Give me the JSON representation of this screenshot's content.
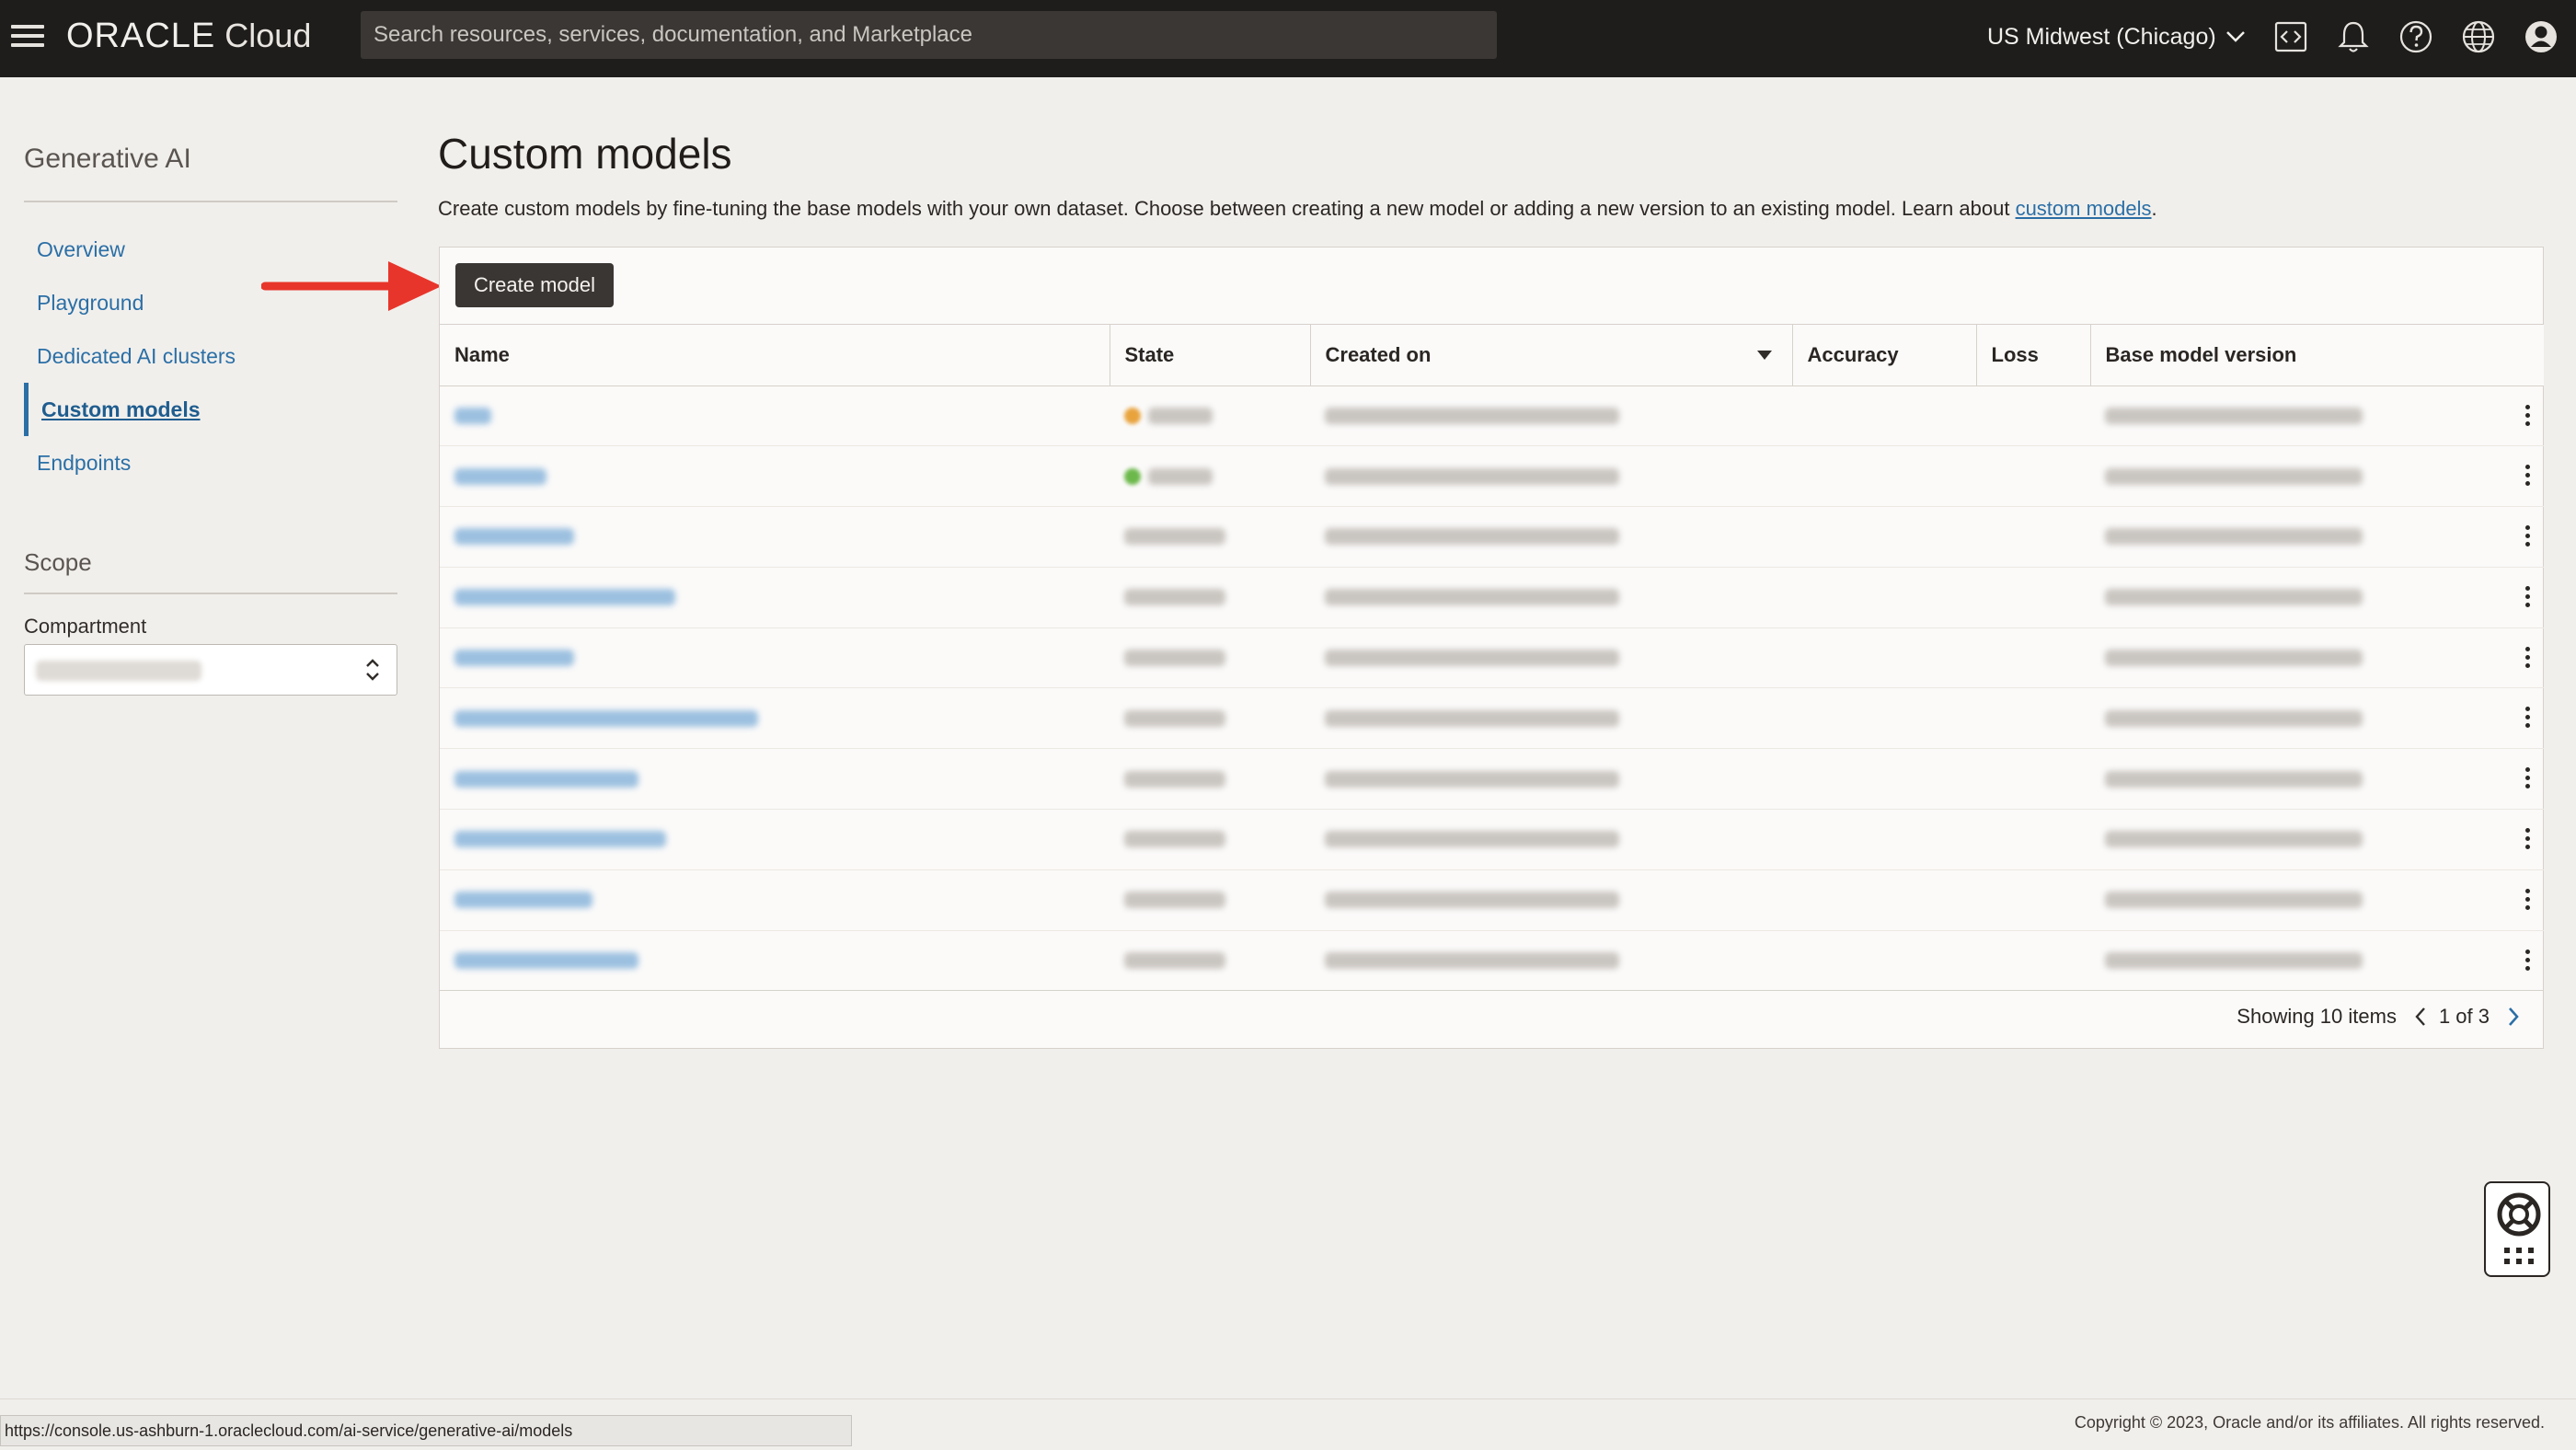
{
  "header": {
    "brand_main": "ORACLE",
    "brand_sub": "Cloud",
    "search_placeholder": "Search resources, services, documentation, and Marketplace",
    "region": "US Midwest (Chicago)",
    "icons": [
      "menu-icon",
      "code-editor-icon",
      "bell-icon",
      "help-icon",
      "globe-icon",
      "user-profile-icon"
    ]
  },
  "sidebar": {
    "title": "Generative AI",
    "items": [
      {
        "label": "Overview",
        "active": false
      },
      {
        "label": "Playground",
        "active": false
      },
      {
        "label": "Dedicated AI clusters",
        "active": false
      },
      {
        "label": "Custom models",
        "active": true
      },
      {
        "label": "Endpoints",
        "active": false
      }
    ],
    "scope_title": "Scope",
    "compartment_label": "Compartment"
  },
  "main": {
    "title": "Custom models",
    "description": "Create custom models by fine-tuning the base models with your own dataset. Choose between creating a new model or adding a new version to an existing model. Learn about ",
    "description_link": "custom models",
    "description_end": ".",
    "create_button": "Create model",
    "columns": [
      "Name",
      "State",
      "Created on",
      "Accuracy",
      "Loss",
      "Base model version"
    ],
    "rows_count": 10,
    "row_state_colors": [
      "#e8a33d",
      "#6cb84b",
      null,
      null,
      null,
      null,
      null,
      null,
      null,
      null
    ],
    "pagination": {
      "summary": "Showing 10 items",
      "page": "1 of 3"
    }
  },
  "footer": {
    "status_url": "https://console.us-ashburn-1.oraclecloud.com/ai-service/generative-ai/models",
    "copyright": "Copyright © 2023, Oracle and/or its affiliates. All rights reserved."
  },
  "colors": {
    "header_bg": "#1f1d1b",
    "link": "#2b6fa6",
    "primary_button": "#3a3633",
    "annotation_arrow": "#e8352b"
  }
}
